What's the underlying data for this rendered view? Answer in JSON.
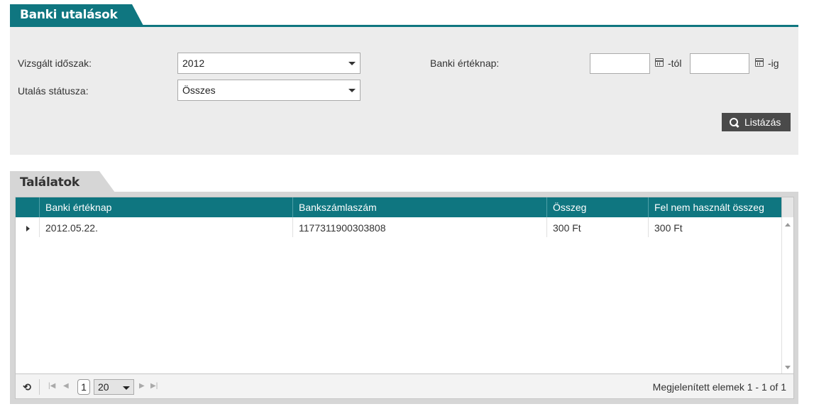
{
  "header": {
    "title": "Banki utalások"
  },
  "filters": {
    "period_label": "Vizsgált időszak:",
    "period_value": "2012",
    "status_label": "Utalás státusza:",
    "status_value": "Összes",
    "value_date_label": "Banki értéknap:",
    "from_value": "",
    "from_suffix": "-tól",
    "to_value": "",
    "to_suffix": "-ig",
    "list_button": "Listázás"
  },
  "results": {
    "title": "Találatok",
    "columns": [
      "Banki értéknap",
      "Bankszámlaszám",
      "Összeg",
      "Fel nem használt összeg"
    ],
    "rows": [
      {
        "date": "2012.05.22.",
        "account": "1177311900303808",
        "amount": "300 Ft",
        "unused": "300 Ft"
      }
    ]
  },
  "pager": {
    "current_page": "1",
    "page_size": "20",
    "info": "Megjelenített elemek 1 - 1 of 1"
  }
}
